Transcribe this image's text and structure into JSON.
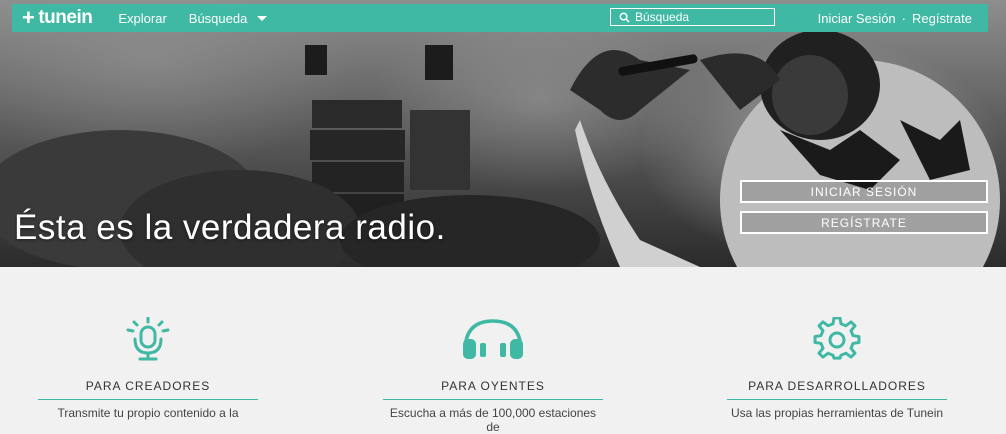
{
  "nav": {
    "logo": "tunein",
    "explore": "Explorar",
    "search_menu": "Búsqueda",
    "search_placeholder": "Búsqueda",
    "login": "Iniciar Sesión",
    "separator": "·",
    "register": "Regístrate"
  },
  "hero": {
    "headline": "Ésta es la verdadera radio.",
    "login_button": "INICIAR SESIÓN",
    "register_button": "REGÍSTRATE"
  },
  "features": [
    {
      "icon": "microphone-icon",
      "title": "PARA CREADORES",
      "desc": "Transmite tu propio contenido a la"
    },
    {
      "icon": "headphones-icon",
      "title": "PARA OYENTES",
      "desc": "Escucha a más de 100,000 estaciones de"
    },
    {
      "icon": "gear-icon",
      "title": "PARA DESARROLLADORES",
      "desc": "Usa las propias herramientas de Tunein"
    }
  ],
  "colors": {
    "accent": "#3fb8a4",
    "background": "#f1f1f1"
  }
}
